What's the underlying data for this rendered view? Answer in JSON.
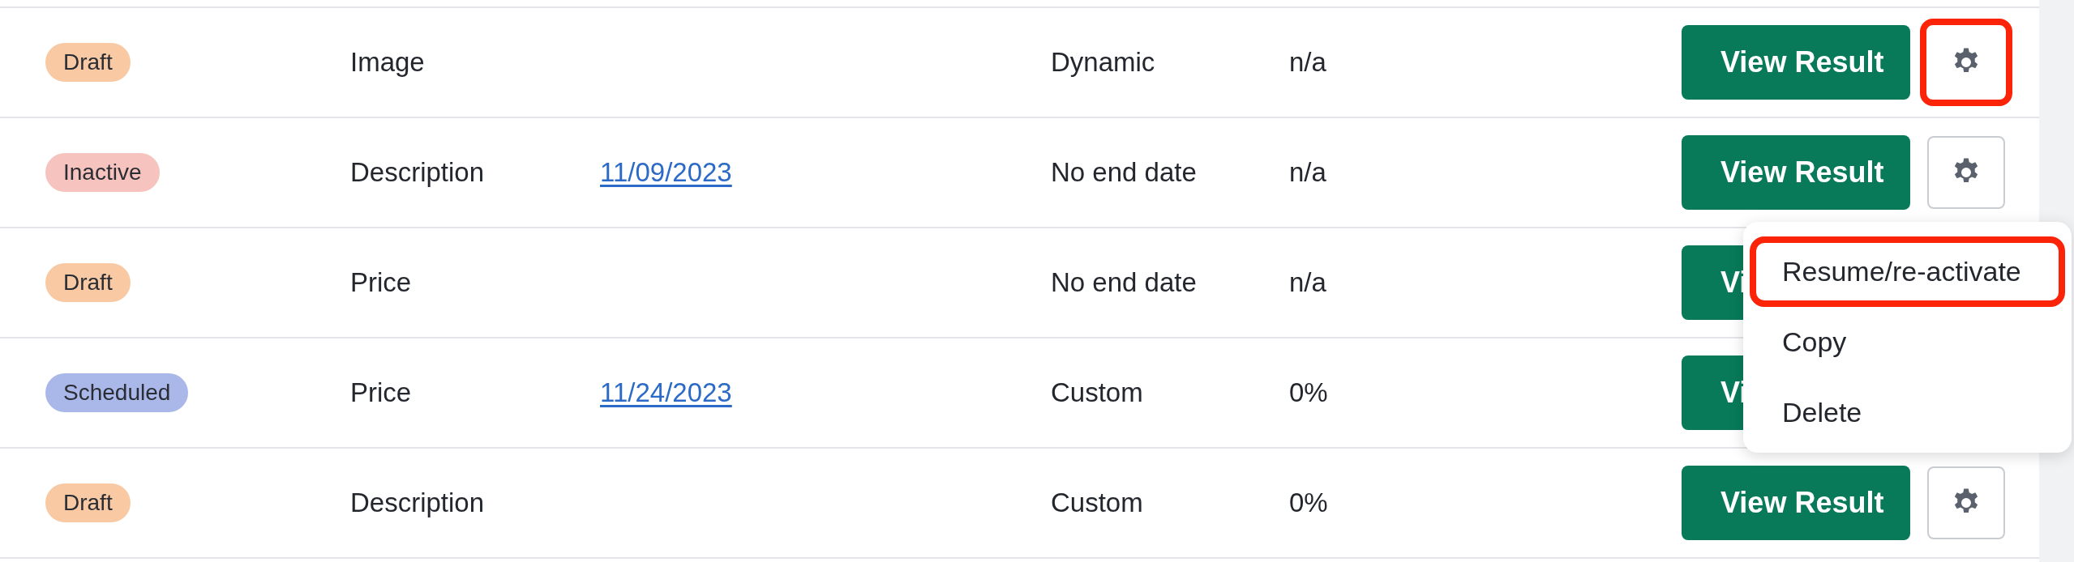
{
  "rows": [
    {
      "status": {
        "label": "Draft",
        "color": "#f8c9a3"
      },
      "type": "Image",
      "date": null,
      "end": "Dynamic",
      "percent": "n/a",
      "view_button": "View Result",
      "gear": {
        "highlighted": true
      }
    },
    {
      "status": {
        "label": "Inactive",
        "color": "#f7c3be"
      },
      "type": "Description",
      "date": "11/09/2023",
      "end": "No end date",
      "percent": "n/a",
      "view_button": "View Result",
      "gear": {
        "highlighted": false
      },
      "menu": [
        {
          "label": "Resume/re-activate",
          "highlighted": true
        },
        {
          "label": "Copy",
          "highlighted": false
        },
        {
          "label": "Delete",
          "highlighted": false
        }
      ]
    },
    {
      "status": {
        "label": "Draft",
        "color": "#f8c9a3"
      },
      "type": "Price",
      "date": null,
      "end": "No end date",
      "percent": "n/a",
      "view_button": "Vi"
    },
    {
      "status": {
        "label": "Scheduled",
        "color": "#aab7e9"
      },
      "type": "Price",
      "date": "11/24/2023",
      "end": "Custom",
      "percent": "0%",
      "view_button": "Vi"
    },
    {
      "status": {
        "label": "Draft",
        "color": "#f8c9a3"
      },
      "type": "Description",
      "date": null,
      "end": "Custom",
      "percent": "0%",
      "view_button": "View Result",
      "gear": {
        "highlighted": false
      }
    }
  ]
}
